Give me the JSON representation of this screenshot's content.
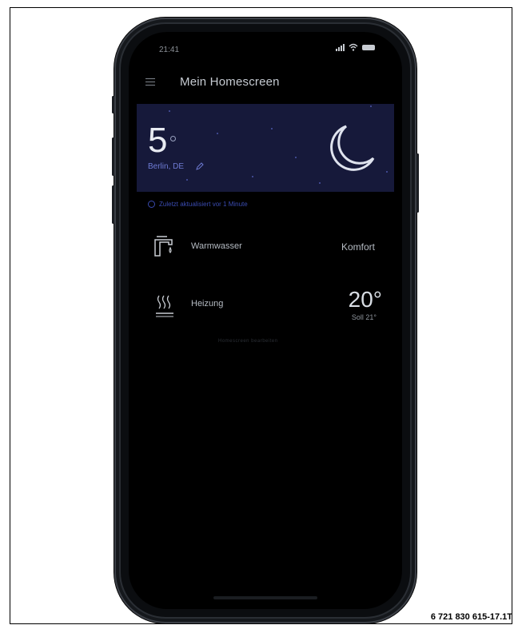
{
  "status_bar": {
    "time": "21:41"
  },
  "nav": {
    "title": "Mein Homescreen",
    "menu_icon": "hamburger-menu-icon"
  },
  "weather": {
    "temperature": "5",
    "location": "Berlin, DE",
    "condition_icon": "crescent-moon-icon",
    "background": "#16193a"
  },
  "update": {
    "text": "Zuletzt aktualisiert vor 1 Minute"
  },
  "rows": [
    {
      "icon": "faucet-icon",
      "label": "Warmwasser",
      "value": "Komfort"
    },
    {
      "icon": "heating-icon",
      "label": "Heizung",
      "value": "20°",
      "sub": "Soll 21°"
    }
  ],
  "footer_hint": "Homescreen bearbeiten",
  "figure_id": "6 721 830 615-17.1T",
  "colors": {
    "accent": "#3a4bb0",
    "screen_bg": "#000000"
  }
}
